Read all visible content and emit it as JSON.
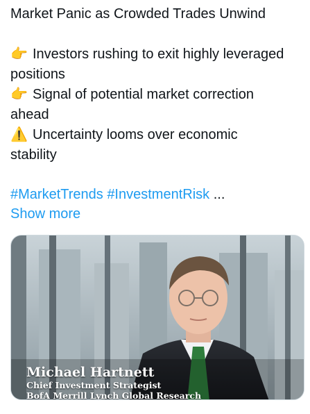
{
  "post": {
    "title": "Market Panic as Crowded Trades Unwind",
    "bullets": [
      {
        "icon": "pointing-right-hand-icon",
        "glyph": "👉",
        "text": "Investors rushing to exit highly leveraged"
      },
      {
        "continuation": "positions"
      },
      {
        "icon": "pointing-right-hand-icon",
        "glyph": "👉",
        "text": "Signal of potential market correction"
      },
      {
        "continuation": "ahead"
      },
      {
        "icon": "warning-icon",
        "glyph": "⚠️",
        "text": "Uncertainty looms over economic"
      },
      {
        "continuation": "stability"
      }
    ],
    "hashtags": [
      "#MarketTrends",
      "#InvestmentRisk"
    ],
    "ellipsis": "...",
    "show_more": "Show more"
  },
  "media": {
    "caption_name": "Michael Hartnett",
    "caption_title": "Chief Investment Strategist",
    "caption_org": "BofA Merrill Lynch Global Research"
  },
  "colors": {
    "link": "#1d9bf0",
    "text": "#0f1419",
    "border": "#cfd9de"
  }
}
